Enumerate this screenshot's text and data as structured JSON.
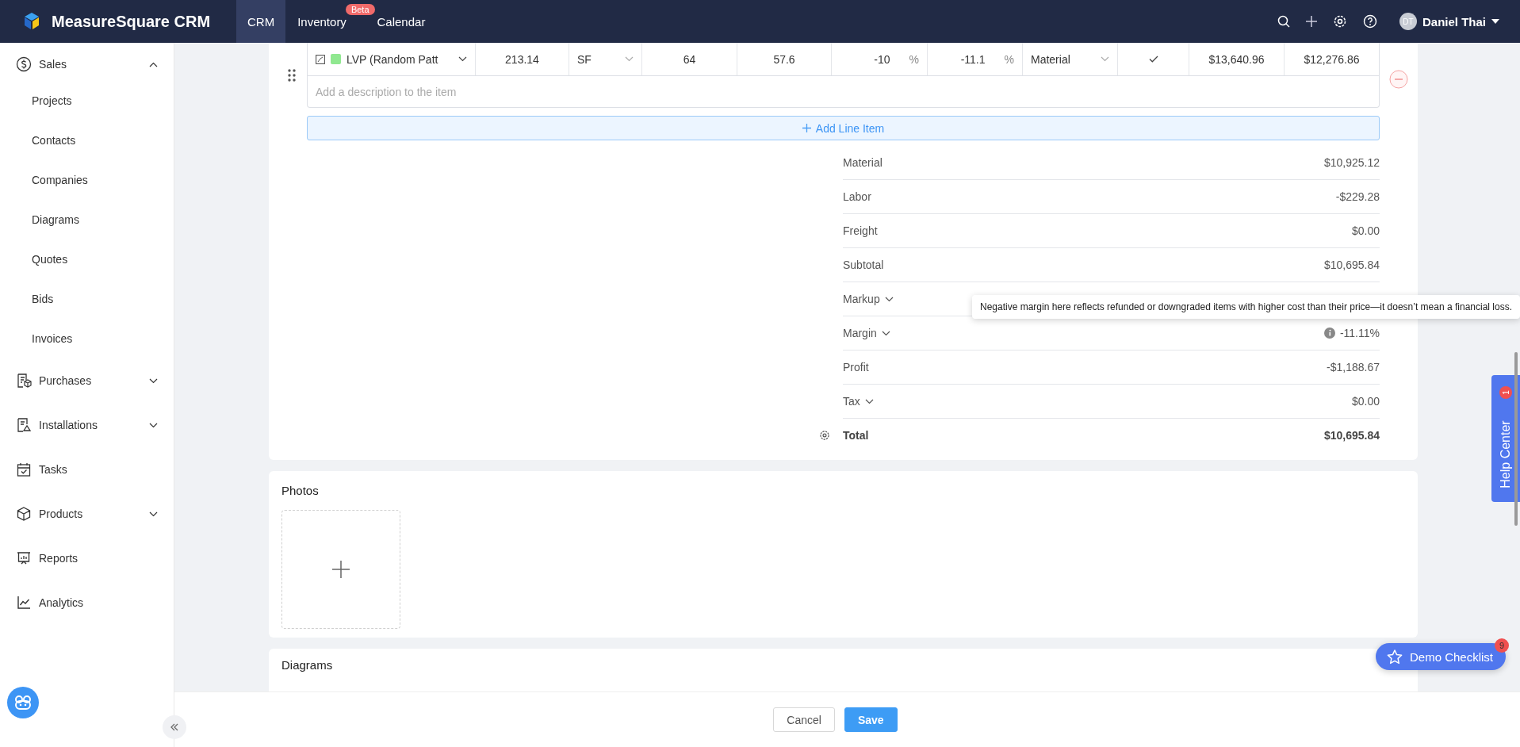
{
  "header": {
    "brand": "MeasureSquare CRM",
    "nav": [
      {
        "label": "CRM",
        "selected": true
      },
      {
        "label": "Inventory",
        "selected": false,
        "badge": "Beta"
      },
      {
        "label": "Calendar",
        "selected": false
      }
    ],
    "user": {
      "initials": "DT",
      "name": "Daniel Thai"
    }
  },
  "sidebar": {
    "items": [
      {
        "label": "Sales",
        "expanded": true,
        "children": [
          {
            "label": "Projects"
          },
          {
            "label": "Contacts"
          },
          {
            "label": "Companies"
          },
          {
            "label": "Diagrams"
          },
          {
            "label": "Quotes"
          },
          {
            "label": "Bids"
          },
          {
            "label": "Invoices"
          }
        ]
      },
      {
        "label": "Purchases",
        "expanded": false
      },
      {
        "label": "Installations",
        "expanded": false
      },
      {
        "label": "Tasks"
      },
      {
        "label": "Products",
        "expanded": false
      },
      {
        "label": "Reports"
      },
      {
        "label": "Analytics"
      }
    ]
  },
  "line_item": {
    "cells": [
      {
        "kind": "product",
        "value": "LVP (Random Patt"
      },
      {
        "kind": "number",
        "value": "213.14"
      },
      {
        "kind": "select",
        "value": "SF"
      },
      {
        "kind": "number",
        "value": "64"
      },
      {
        "kind": "number",
        "value": "57.6"
      },
      {
        "kind": "percent",
        "value": "-10",
        "unit": "%"
      },
      {
        "kind": "percent",
        "value": "-11.1",
        "unit": "%"
      },
      {
        "kind": "select",
        "value": "Material"
      },
      {
        "kind": "check",
        "checked": true
      },
      {
        "kind": "number",
        "value": "$13,640.96"
      },
      {
        "kind": "number",
        "value": "$12,276.86"
      }
    ],
    "description": {
      "placeholder": "Add a description to the item"
    }
  },
  "add_line_item": "Add Line Item",
  "summary": [
    {
      "label": "Material",
      "value": "$10,925.12",
      "expandable": false
    },
    {
      "label": "Labor",
      "value": "-$229.28",
      "expandable": false
    },
    {
      "label": "Freight",
      "value": "$0.00",
      "expandable": false
    },
    {
      "label": "Subtotal",
      "value": "$10,695.84",
      "expandable": false
    },
    {
      "label": "Markup",
      "expandable": true
    },
    {
      "label": "Margin",
      "value": "-11.11%",
      "expandable": true,
      "info": true
    },
    {
      "label": "Profit",
      "value": "-$1,188.67",
      "expandable": false
    },
    {
      "label": "Tax",
      "value": "$0.00",
      "expandable": true
    },
    {
      "label": "Total",
      "value": "$10,695.84",
      "expandable": false,
      "kind": "total"
    }
  ],
  "tooltip": "Negative margin here reflects refunded or downgraded items with higher cost than their price—it doesn’t mean a financial loss.",
  "photos": {
    "title": "Photos"
  },
  "diagrams": {
    "title": "Diagrams"
  },
  "footer": {
    "buttons": [
      {
        "label": "Cancel",
        "kind": "default"
      },
      {
        "label": "Save",
        "kind": "primary"
      }
    ]
  },
  "help_center": {
    "label": "Help Center",
    "badge": "1"
  },
  "demo_checklist": {
    "label": "Demo Checklist",
    "badge": "9"
  }
}
